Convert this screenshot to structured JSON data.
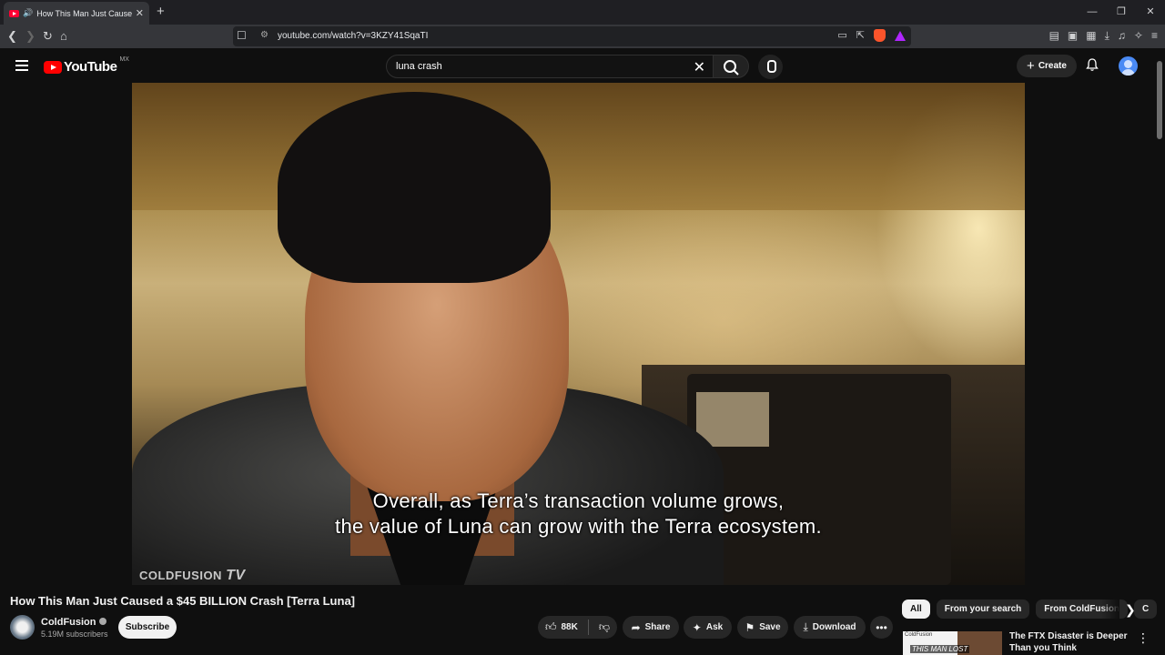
{
  "browser": {
    "tab_title": "How This Man Just Caused a",
    "new_tab": "+",
    "url": "youtube.com/watch?v=3KZY41SqaTI",
    "window_controls": [
      "—",
      "❐",
      "✕"
    ]
  },
  "youtube": {
    "logo_text": "YouTube",
    "country_code": "MX",
    "search_query": "luna crash",
    "create_label": "Create"
  },
  "video": {
    "subtitle_line1": "Overall, as Terra’s transaction volume grows,",
    "subtitle_line2": "the value of Luna can grow with the Terra ecosystem.",
    "watermark": "COLDFUSION",
    "watermark_tv": "TV",
    "title": "How This Man Just Caused a $45 BILLION Crash [Terra Luna]"
  },
  "channel": {
    "name": "ColdFusion",
    "subscribers": "5.19M subscribers",
    "subscribe_label": "Subscribe"
  },
  "actions": {
    "likes": "88K",
    "share": "Share",
    "ask": "Ask",
    "save": "Save",
    "download": "Download"
  },
  "chips": [
    "All",
    "From your search",
    "From ColdFusion",
    "C"
  ],
  "recommendation": {
    "title": "The FTX Disaster is Deeper Than you Think",
    "thumb_brand": "ColdFusion",
    "thumb_caption": "THIS MAN LOST"
  },
  "colors": {
    "background": "#0f0f0f",
    "youtube_red": "#ff0000",
    "chip_active": "#f1f1f1"
  }
}
